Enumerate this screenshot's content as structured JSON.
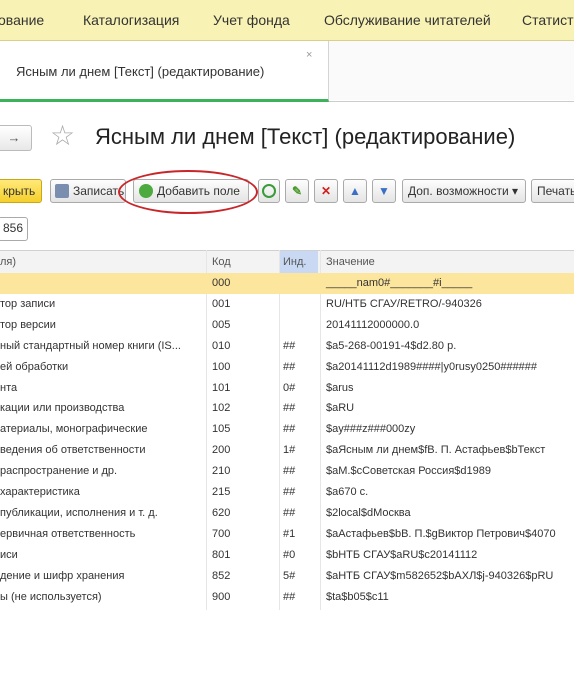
{
  "menu": [
    "ование",
    "Каталогизация",
    "Учет фонда",
    "Обслуживание читателей",
    "Статист"
  ],
  "tab": {
    "label": "Ясным ли днем [Текст] (редактирование)",
    "close": "×"
  },
  "nav": {
    "forward": "→"
  },
  "title": "Ясным ли днем [Текст] (редактирование)",
  "toolbar": {
    "close": "крыть",
    "save": "Записать",
    "add_field": "Добавить поле",
    "more": "Доп. возможности ▾",
    "print": "Печать"
  },
  "record_number": "856",
  "table": {
    "headers": {
      "name": "ля)",
      "code": "Код",
      "ind": "Инд.",
      "value": "Значение"
    },
    "rows": [
      {
        "name": "",
        "code": "000",
        "ind": "",
        "value": "_____nam0#_______#i_____",
        "selected": true
      },
      {
        "name": "тор записи",
        "code": "001",
        "ind": "",
        "value": "RU/НТБ СГАУ/RETRO/-940326"
      },
      {
        "name": "тор версии",
        "code": "005",
        "ind": "",
        "value": "20141112000000.0"
      },
      {
        "name": "ный стандартный номер книги (IS...",
        "code": "010",
        "ind": "##",
        "value": "$a5-268-00191-4$d2.80 р."
      },
      {
        "name": "ей обработки",
        "code": "100",
        "ind": "##",
        "value": "$a20141112d1989####|y0rusy0250######"
      },
      {
        "name": "нта",
        "code": "101",
        "ind": "0#",
        "value": "$arus"
      },
      {
        "name": "кации или производства",
        "code": "102",
        "ind": "##",
        "value": "$aRU"
      },
      {
        "name": "атериалы, монографические",
        "code": "105",
        "ind": "##",
        "value": "$ay###z###000zy"
      },
      {
        "name": "ведения об ответственности",
        "code": "200",
        "ind": "1#",
        "value": "$aЯсным ли днем$fВ. П. Астафьев$bТекст"
      },
      {
        "name": "распространение и др.",
        "code": "210",
        "ind": "##",
        "value": "$aМ.$cСоветская Россия$d1989"
      },
      {
        "name": "характеристика",
        "code": "215",
        "ind": "##",
        "value": "$a670 с."
      },
      {
        "name": "публикации, исполнения и т. д.",
        "code": "620",
        "ind": "##",
        "value": "$2local$dМосква"
      },
      {
        "name": "ервичная ответственность",
        "code": "700",
        "ind": "#1",
        "value": "$aАстафьев$bВ. П.$gВиктор Петрович$4070"
      },
      {
        "name": "иси",
        "code": "801",
        "ind": "#0",
        "value": "$bНТБ СГАУ$aRU$c20141112"
      },
      {
        "name": "дение и шифр хранения",
        "code": "852",
        "ind": "5#",
        "value": "$aНТБ СГАУ$m582652$bАХЛ$j-940326$pRU"
      },
      {
        "name": "ы (не используется)",
        "code": "900",
        "ind": "##",
        "value": "$ta$b05$c11"
      }
    ]
  },
  "colors": {
    "menu_bg": "#f8f2b4",
    "selected_row": "#fce59c",
    "tab_accent": "#3cb35a",
    "highlight_oval": "#c8262a"
  }
}
